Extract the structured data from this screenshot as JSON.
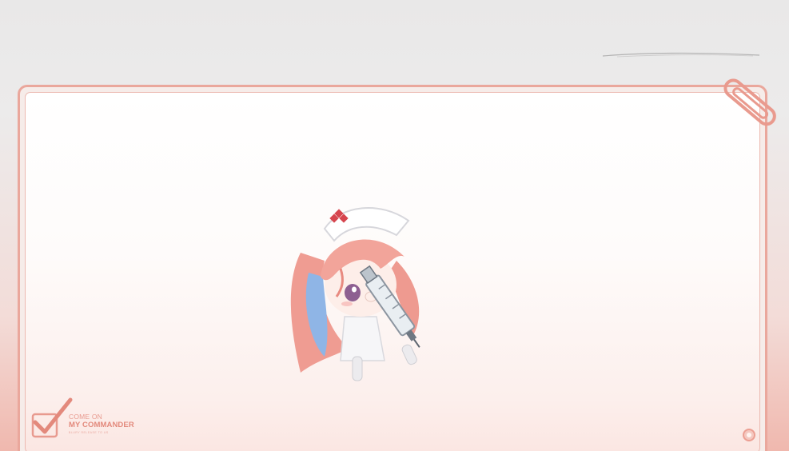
{
  "logo": {
    "line1": "COME ON",
    "line2": "MY COMMANDER",
    "line3": "BLURY RELEASE TO US"
  },
  "icons": {
    "paper_clip": "paper-clip-icon",
    "checkmark": "checkmark-box-icon",
    "corner_button": "circle-button-icon",
    "character": "nurse-chibi-character"
  },
  "colors": {
    "accent": "#eaa79c",
    "logo": "#e48f83",
    "panel": "#ffffff"
  }
}
